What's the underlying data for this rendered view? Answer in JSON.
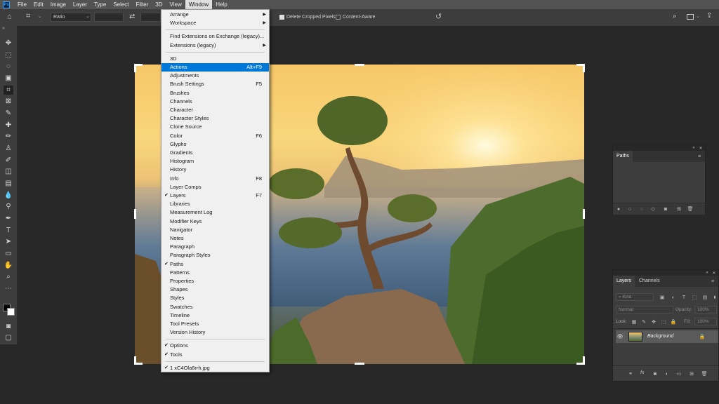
{
  "app": {
    "logo": "Ps"
  },
  "menubar": {
    "items": [
      "File",
      "Edit",
      "Image",
      "Layer",
      "Type",
      "Select",
      "Filter",
      "3D",
      "View",
      "Window",
      "Help"
    ],
    "active_item": "Window"
  },
  "options_bar": {
    "ratio_label": "Ratio",
    "delete_cropped_label": "Delete Cropped Pixels",
    "delete_cropped_checked": true,
    "content_aware_label": "Content-Aware",
    "content_aware_checked": false
  },
  "window_menu": {
    "highlight_color": "#0078d7",
    "items": [
      {
        "label": "Arrange",
        "submenu": true
      },
      {
        "label": "Workspace",
        "submenu": true
      },
      {
        "separator": true
      },
      {
        "label": "Find Extensions on Exchange (legacy)..."
      },
      {
        "label": "Extensions (legacy)",
        "submenu": true
      },
      {
        "separator": true
      },
      {
        "label": "3D"
      },
      {
        "label": "Actions",
        "shortcut": "Alt+F9",
        "highlighted": true
      },
      {
        "label": "Adjustments"
      },
      {
        "label": "Brush Settings",
        "shortcut": "F5"
      },
      {
        "label": "Brushes"
      },
      {
        "label": "Channels"
      },
      {
        "label": "Character"
      },
      {
        "label": "Character Styles"
      },
      {
        "label": "Clone Source"
      },
      {
        "label": "Color",
        "shortcut": "F6"
      },
      {
        "label": "Glyphs"
      },
      {
        "label": "Gradients"
      },
      {
        "label": "Histogram"
      },
      {
        "label": "History"
      },
      {
        "label": "Info",
        "shortcut": "F8"
      },
      {
        "label": "Layer Comps"
      },
      {
        "label": "Layers",
        "shortcut": "F7",
        "checked": true
      },
      {
        "label": "Libraries"
      },
      {
        "label": "Measurement Log"
      },
      {
        "label": "Modifier Keys"
      },
      {
        "label": "Navigator"
      },
      {
        "label": "Notes"
      },
      {
        "label": "Paragraph"
      },
      {
        "label": "Paragraph Styles"
      },
      {
        "label": "Paths",
        "checked": true
      },
      {
        "label": "Patterns"
      },
      {
        "label": "Properties"
      },
      {
        "label": "Shapes"
      },
      {
        "label": "Styles"
      },
      {
        "label": "Swatches"
      },
      {
        "label": "Timeline"
      },
      {
        "label": "Tool Presets"
      },
      {
        "label": "Version History"
      },
      {
        "separator": true
      },
      {
        "label": "Options",
        "checked": true
      },
      {
        "label": "Tools",
        "checked": true
      },
      {
        "separator": true
      },
      {
        "label": "1 xC4Ola6rrh.jpg",
        "checked": true
      }
    ]
  },
  "paths_panel": {
    "tab": "Paths"
  },
  "layers_panel": {
    "tabs": [
      "Layers",
      "Channels"
    ],
    "search_placeholder": "Kind",
    "blend_mode": "Normal",
    "opacity_label": "Opacity:",
    "opacity_value": "100%",
    "lock_label": "Lock:",
    "fill_label": "Fill:",
    "fill_value": "100%",
    "layer_name": "Background",
    "fx_label": "fx"
  }
}
